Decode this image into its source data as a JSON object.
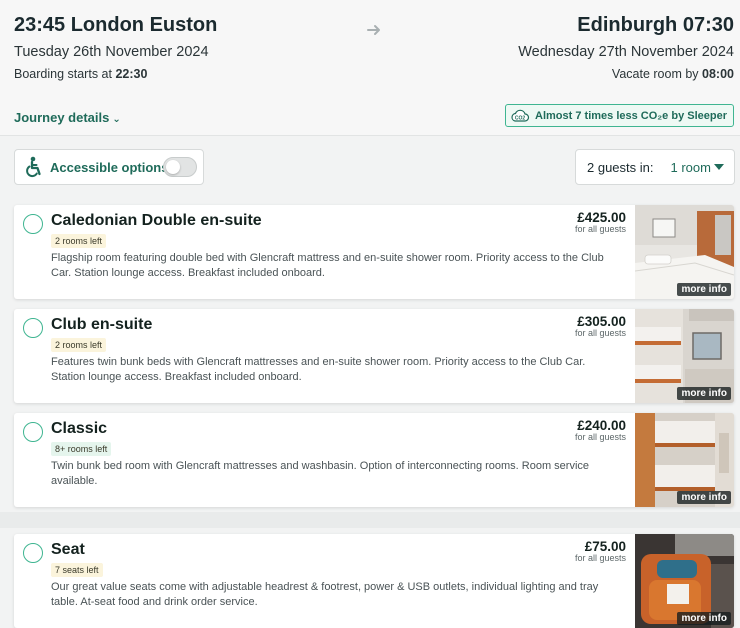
{
  "journey": {
    "departure_title": "23:45 London Euston",
    "departure_date": "Tuesday 26th November 2024",
    "boarding_prefix": "Boarding starts at ",
    "boarding_time": "22:30",
    "arrival_title": "Edinburgh 07:30",
    "arrival_date": "Wednesday 27th November 2024",
    "vacate_prefix": "Vacate room by ",
    "vacate_time": "08:00",
    "details_link": "Journey details",
    "co2_message": "Almost 7 times less CO₂e by Sleeper",
    "co2_icon_label": "CO2"
  },
  "filters": {
    "accessible_label": "Accessible options",
    "accessible_enabled": false,
    "guests_label": "2 guests in:",
    "rooms_value": "1 room"
  },
  "rooms": [
    {
      "title": "Caledonian Double en-suite",
      "availability": "2 rooms left",
      "description": "Flagship room featuring double bed with Glencraft mattress and en-suite shower room. Priority access to the Club Car. Station lounge access. Breakfast included onboard.",
      "price": "£425.00",
      "price_note": "for all guests",
      "more_info": "more info"
    },
    {
      "title": "Club en-suite",
      "availability": "2 rooms left",
      "description": "Features twin bunk beds with Glencraft mattresses and en-suite shower room. Priority access to the Club Car. Station lounge access. Breakfast included onboard.",
      "price": "£305.00",
      "price_note": "for all guests",
      "more_info": "more info"
    },
    {
      "title": "Classic",
      "availability": "8+ rooms left",
      "description": "Twin bunk bed room with Glencraft mattresses and washbasin. Option of interconnecting rooms. Room service available.",
      "price": "£240.00",
      "price_note": "for all guests",
      "more_info": "more info"
    },
    {
      "title": "Seat",
      "availability": "7 seats left",
      "description": "Our great value seats come with adjustable headrest & footrest, power & USB outlets, individual lighting and tray table. At-seat food and drink order service.",
      "price": "£75.00",
      "price_note": "for all guests",
      "more_info": "more info"
    }
  ],
  "colors": {
    "brand_green": "#1f6b5a",
    "accent_mint": "#3fb591",
    "badge_yellow": "#fbf4dc",
    "badge_green": "#e5f5ed"
  }
}
